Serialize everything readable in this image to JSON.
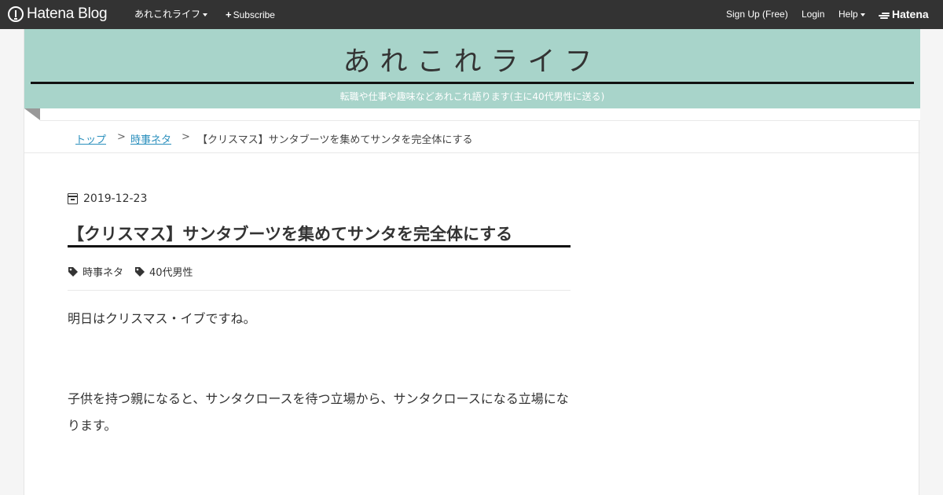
{
  "navbar": {
    "logo_text": "Hatena Blog",
    "blog_menu": "あれこれライフ",
    "subscribe": "Subscribe",
    "signup": "Sign Up (Free)",
    "login": "Login",
    "help": "Help",
    "brand": "Hatena"
  },
  "blog": {
    "title": "あれこれライフ",
    "description": "転職や仕事や趣味などあれこれ語ります(主に40代男性に送る)",
    "header_color": "#a8d4ca"
  },
  "breadcrumb": {
    "items": [
      "トップ",
      "時事ネタ"
    ],
    "separator": ">",
    "current": "【クリスマス】サンタブーツを集めてサンタを完全体にする"
  },
  "article": {
    "date": "2019-12-23",
    "title": "【クリスマス】サンタブーツを集めてサンタを完全体にする",
    "tags": [
      "時事ネタ",
      "40代男性"
    ],
    "paragraphs": [
      "明日はクリスマス・イブですね。",
      "子供を持つ親になると、サンタクロースを待つ立場から、サンタクロースになる立場になります。"
    ]
  }
}
